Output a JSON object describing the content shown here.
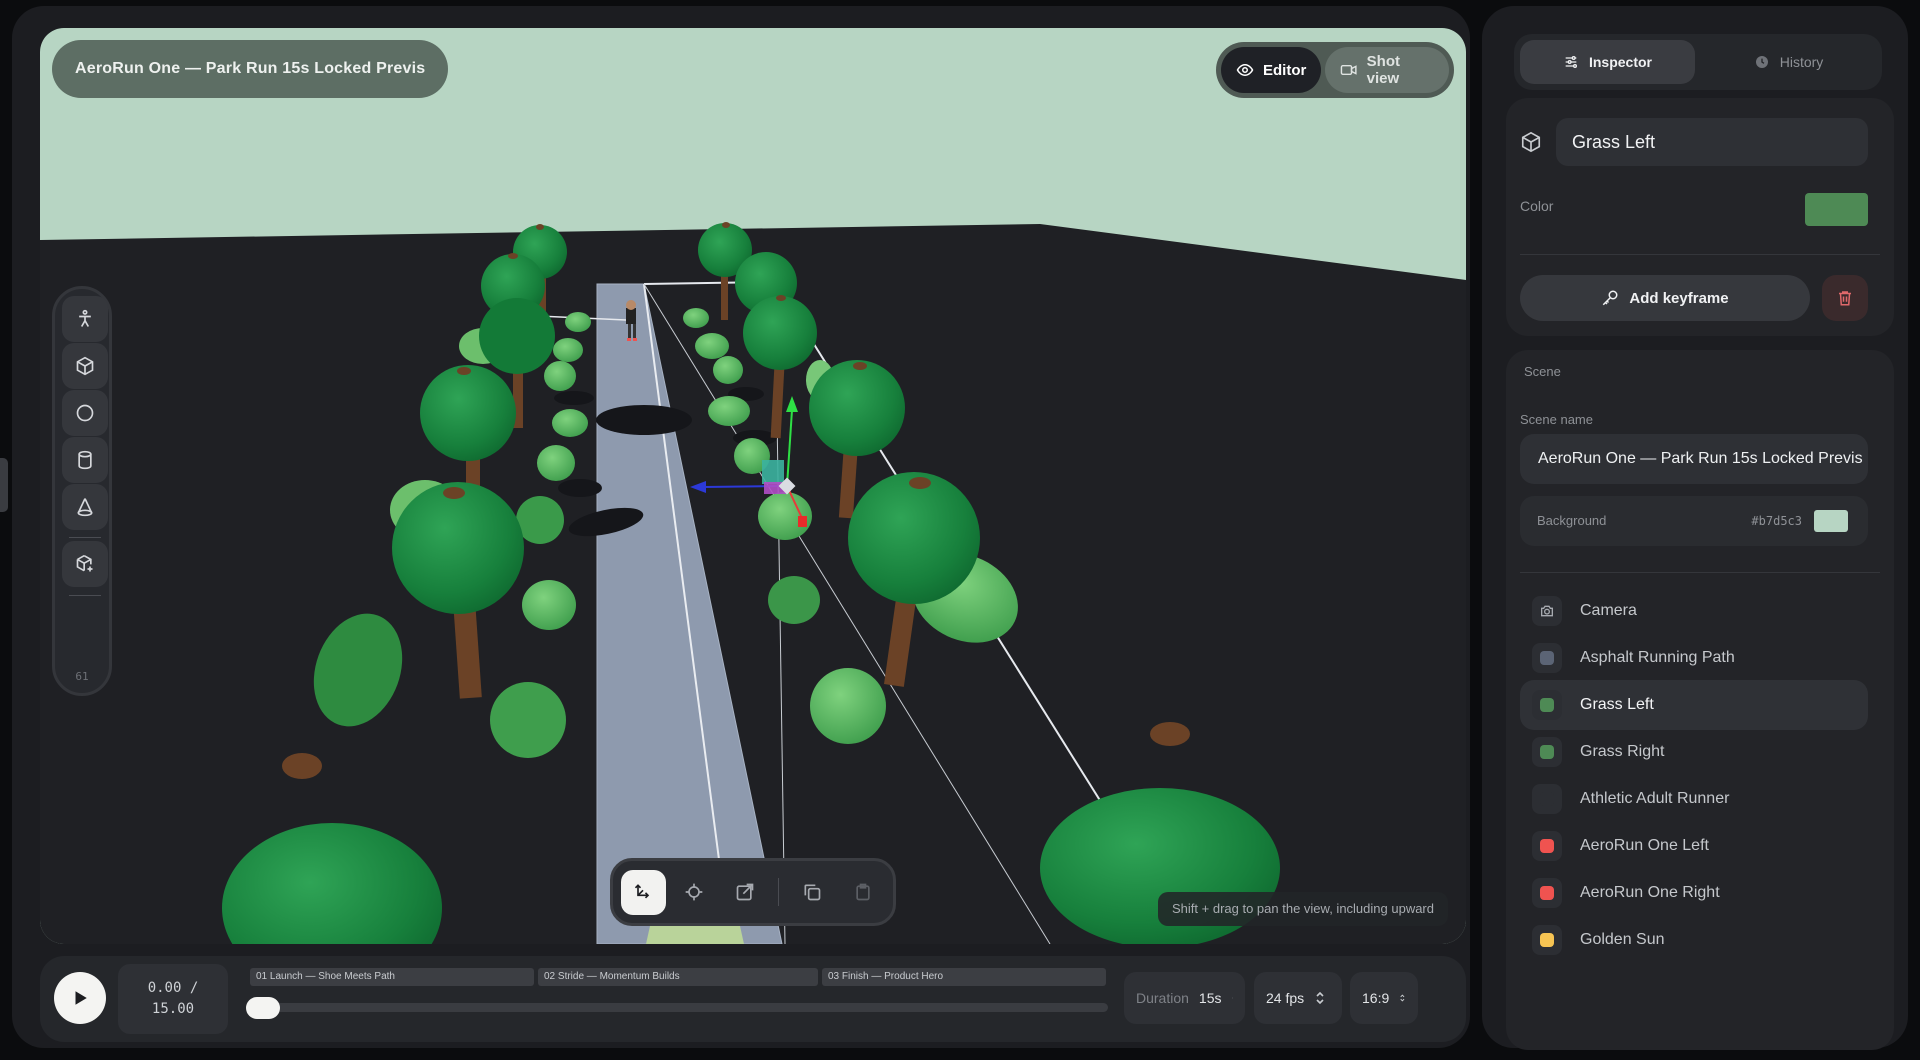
{
  "viewport": {
    "title": "AeroRun One — Park Run 15s Locked Previs",
    "hint": "Shift + drag to pan the view, including upward"
  },
  "view_toggle": {
    "editor_label": "Editor",
    "shot_label": "Shot view"
  },
  "tool_rail": {
    "count": "61",
    "tools": [
      "person-icon",
      "cube-icon",
      "sphere-icon",
      "cylinder-icon",
      "cone-icon",
      "add-model-icon"
    ]
  },
  "transform_bar": {
    "tools": [
      "move-icon",
      "rotate-icon",
      "scale-icon",
      "duplicate-icon",
      "paste-icon"
    ]
  },
  "timeline": {
    "time_current": "0.00 /",
    "time_total": "15.00",
    "segments": [
      "01 Launch — Shoe Meets Path",
      "02 Stride — Momentum Builds",
      "03 Finish — Product Hero"
    ],
    "progress": 0,
    "duration_label": "Duration",
    "duration_value": "15s",
    "fps_value": "24 fps",
    "aspect_value": "16:9"
  },
  "inspector": {
    "tab_inspector": "Inspector",
    "tab_history": "History",
    "object_name": "Grass Left",
    "color_label": "Color",
    "color_value": "#4e8a55",
    "add_keyframe_label": "Add keyframe"
  },
  "scene": {
    "section_label": "Scene",
    "name_label": "Scene name",
    "name_value": "AeroRun One — Park Run 15s Locked Previs",
    "background_label": "Background",
    "background_hex": "#b7d5c3",
    "objects": [
      {
        "name": "Camera",
        "kind": "camera",
        "color": ""
      },
      {
        "name": "Asphalt Running Path",
        "kind": "swatch",
        "color": "#5b6475"
      },
      {
        "name": "Grass Left",
        "kind": "swatch",
        "color": "#4e8a55",
        "selected": true
      },
      {
        "name": "Grass Right",
        "kind": "swatch",
        "color": "#4e8a55"
      },
      {
        "name": "Athletic Adult Runner",
        "kind": "swatch",
        "color": "#2c2e33"
      },
      {
        "name": "AeroRun One Left",
        "kind": "swatch",
        "color": "#ef5350"
      },
      {
        "name": "AeroRun One Right",
        "kind": "swatch",
        "color": "#ef5350"
      },
      {
        "name": "Golden Sun",
        "kind": "swatch",
        "color": "#f6c453"
      }
    ]
  }
}
